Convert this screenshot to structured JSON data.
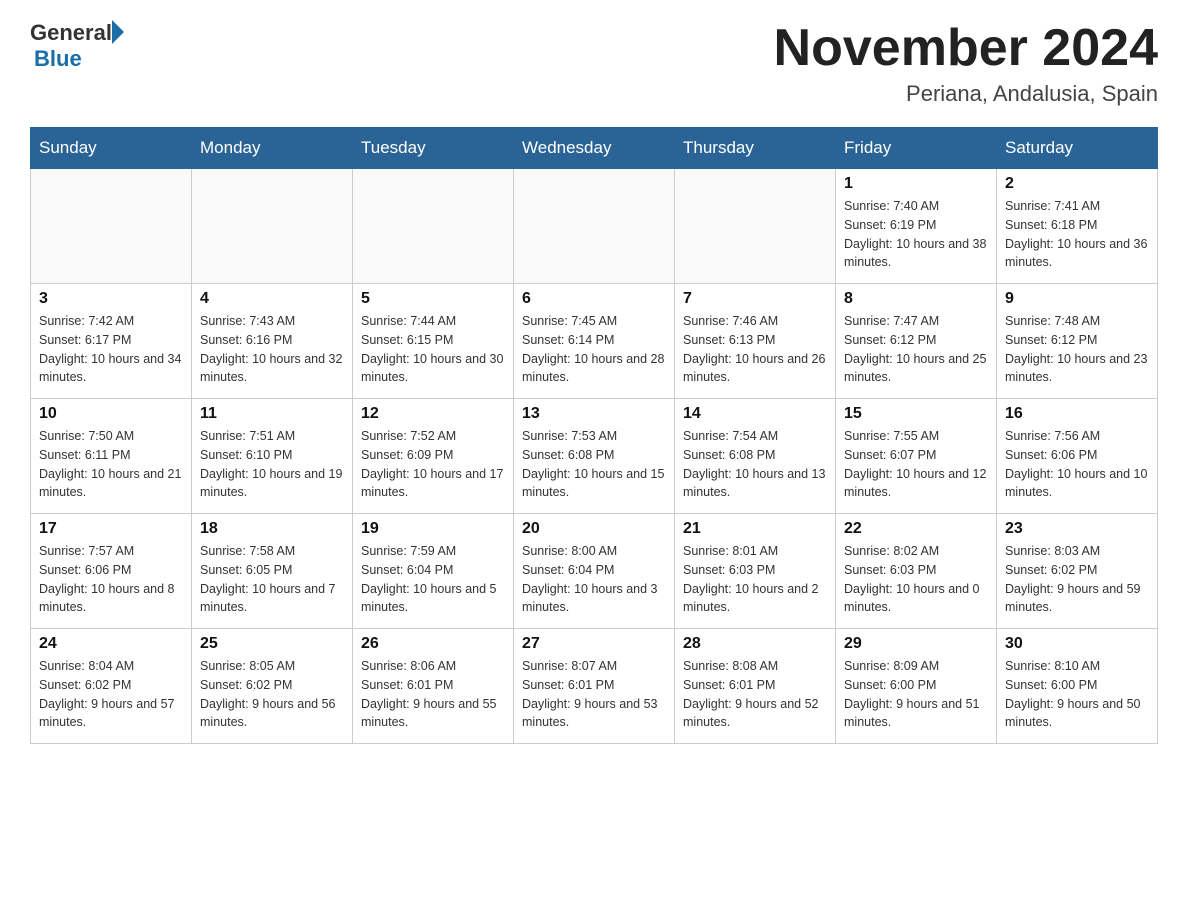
{
  "logo": {
    "general": "General",
    "blue": "Blue"
  },
  "title": "November 2024",
  "location": "Periana, Andalusia, Spain",
  "days_of_week": [
    "Sunday",
    "Monday",
    "Tuesday",
    "Wednesday",
    "Thursday",
    "Friday",
    "Saturday"
  ],
  "weeks": [
    [
      {
        "day": "",
        "info": ""
      },
      {
        "day": "",
        "info": ""
      },
      {
        "day": "",
        "info": ""
      },
      {
        "day": "",
        "info": ""
      },
      {
        "day": "",
        "info": ""
      },
      {
        "day": "1",
        "info": "Sunrise: 7:40 AM\nSunset: 6:19 PM\nDaylight: 10 hours and 38 minutes."
      },
      {
        "day": "2",
        "info": "Sunrise: 7:41 AM\nSunset: 6:18 PM\nDaylight: 10 hours and 36 minutes."
      }
    ],
    [
      {
        "day": "3",
        "info": "Sunrise: 7:42 AM\nSunset: 6:17 PM\nDaylight: 10 hours and 34 minutes."
      },
      {
        "day": "4",
        "info": "Sunrise: 7:43 AM\nSunset: 6:16 PM\nDaylight: 10 hours and 32 minutes."
      },
      {
        "day": "5",
        "info": "Sunrise: 7:44 AM\nSunset: 6:15 PM\nDaylight: 10 hours and 30 minutes."
      },
      {
        "day": "6",
        "info": "Sunrise: 7:45 AM\nSunset: 6:14 PM\nDaylight: 10 hours and 28 minutes."
      },
      {
        "day": "7",
        "info": "Sunrise: 7:46 AM\nSunset: 6:13 PM\nDaylight: 10 hours and 26 minutes."
      },
      {
        "day": "8",
        "info": "Sunrise: 7:47 AM\nSunset: 6:12 PM\nDaylight: 10 hours and 25 minutes."
      },
      {
        "day": "9",
        "info": "Sunrise: 7:48 AM\nSunset: 6:12 PM\nDaylight: 10 hours and 23 minutes."
      }
    ],
    [
      {
        "day": "10",
        "info": "Sunrise: 7:50 AM\nSunset: 6:11 PM\nDaylight: 10 hours and 21 minutes."
      },
      {
        "day": "11",
        "info": "Sunrise: 7:51 AM\nSunset: 6:10 PM\nDaylight: 10 hours and 19 minutes."
      },
      {
        "day": "12",
        "info": "Sunrise: 7:52 AM\nSunset: 6:09 PM\nDaylight: 10 hours and 17 minutes."
      },
      {
        "day": "13",
        "info": "Sunrise: 7:53 AM\nSunset: 6:08 PM\nDaylight: 10 hours and 15 minutes."
      },
      {
        "day": "14",
        "info": "Sunrise: 7:54 AM\nSunset: 6:08 PM\nDaylight: 10 hours and 13 minutes."
      },
      {
        "day": "15",
        "info": "Sunrise: 7:55 AM\nSunset: 6:07 PM\nDaylight: 10 hours and 12 minutes."
      },
      {
        "day": "16",
        "info": "Sunrise: 7:56 AM\nSunset: 6:06 PM\nDaylight: 10 hours and 10 minutes."
      }
    ],
    [
      {
        "day": "17",
        "info": "Sunrise: 7:57 AM\nSunset: 6:06 PM\nDaylight: 10 hours and 8 minutes."
      },
      {
        "day": "18",
        "info": "Sunrise: 7:58 AM\nSunset: 6:05 PM\nDaylight: 10 hours and 7 minutes."
      },
      {
        "day": "19",
        "info": "Sunrise: 7:59 AM\nSunset: 6:04 PM\nDaylight: 10 hours and 5 minutes."
      },
      {
        "day": "20",
        "info": "Sunrise: 8:00 AM\nSunset: 6:04 PM\nDaylight: 10 hours and 3 minutes."
      },
      {
        "day": "21",
        "info": "Sunrise: 8:01 AM\nSunset: 6:03 PM\nDaylight: 10 hours and 2 minutes."
      },
      {
        "day": "22",
        "info": "Sunrise: 8:02 AM\nSunset: 6:03 PM\nDaylight: 10 hours and 0 minutes."
      },
      {
        "day": "23",
        "info": "Sunrise: 8:03 AM\nSunset: 6:02 PM\nDaylight: 9 hours and 59 minutes."
      }
    ],
    [
      {
        "day": "24",
        "info": "Sunrise: 8:04 AM\nSunset: 6:02 PM\nDaylight: 9 hours and 57 minutes."
      },
      {
        "day": "25",
        "info": "Sunrise: 8:05 AM\nSunset: 6:02 PM\nDaylight: 9 hours and 56 minutes."
      },
      {
        "day": "26",
        "info": "Sunrise: 8:06 AM\nSunset: 6:01 PM\nDaylight: 9 hours and 55 minutes."
      },
      {
        "day": "27",
        "info": "Sunrise: 8:07 AM\nSunset: 6:01 PM\nDaylight: 9 hours and 53 minutes."
      },
      {
        "day": "28",
        "info": "Sunrise: 8:08 AM\nSunset: 6:01 PM\nDaylight: 9 hours and 52 minutes."
      },
      {
        "day": "29",
        "info": "Sunrise: 8:09 AM\nSunset: 6:00 PM\nDaylight: 9 hours and 51 minutes."
      },
      {
        "day": "30",
        "info": "Sunrise: 8:10 AM\nSunset: 6:00 PM\nDaylight: 9 hours and 50 minutes."
      }
    ]
  ]
}
